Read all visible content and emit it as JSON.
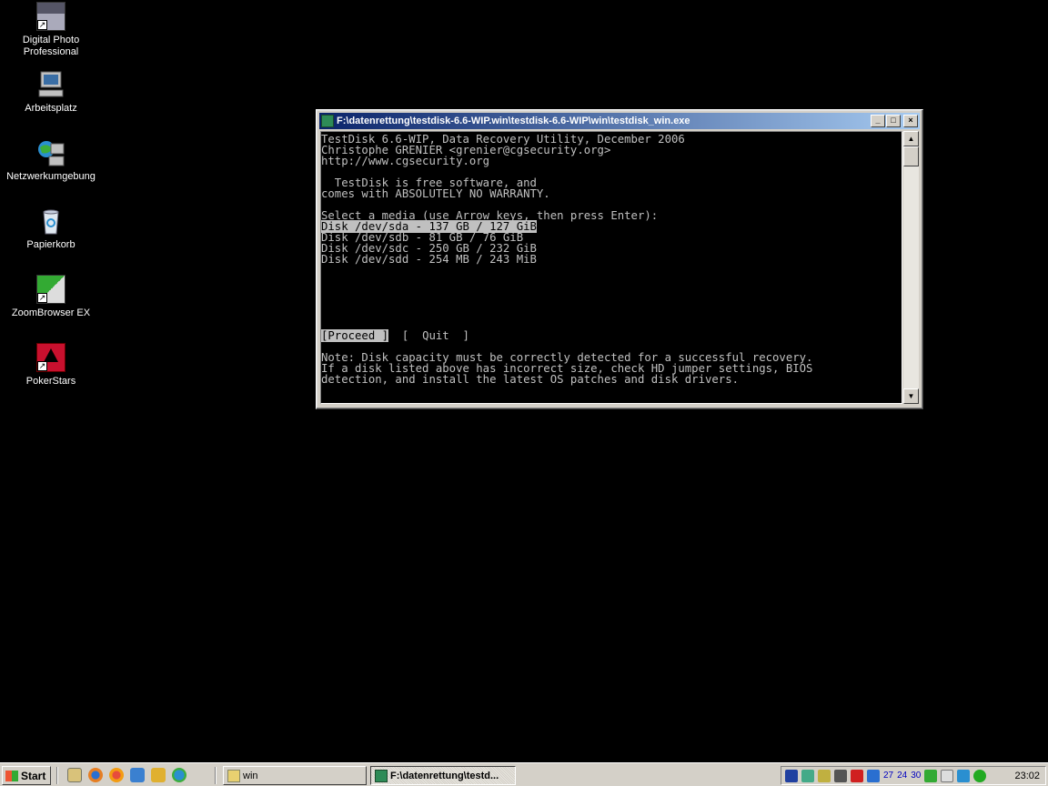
{
  "desktop": {
    "icons": [
      {
        "label": "Digital Photo Professional"
      },
      {
        "label": "Arbeitsplatz"
      },
      {
        "label": "Netzwerkumgebung"
      },
      {
        "label": "Papierkorb"
      },
      {
        "label": "ZoomBrowser EX"
      },
      {
        "label": "PokerStars"
      }
    ]
  },
  "window": {
    "title": "F:\\datenrettung\\testdisk-6.6-WIP.win\\testdisk-6.6-WIP\\win\\testdisk_win.exe",
    "minimize": "_",
    "maximize": "□",
    "close": "×",
    "console": {
      "header1": "TestDisk 6.6-WIP, Data Recovery Utility, December 2006",
      "header2": "Christophe GRENIER <grenier@cgsecurity.org>",
      "header3": "http://www.cgsecurity.org",
      "license1": "  TestDisk is free software, and",
      "license2": "comes with ABSOLUTELY NO WARRANTY.",
      "prompt": "Select a media (use Arrow keys, then press Enter):",
      "disks": [
        "Disk /dev/sda - 137 GB / 127 GiB",
        "Disk /dev/sdb - 81 GB / 76 GiB",
        "Disk /dev/sdc - 250 GB / 232 GiB",
        "Disk /dev/sdd - 254 MB / 243 MiB"
      ],
      "proceed": "[Proceed ]",
      "quit": "  [  Quit  ]",
      "note1": "Note: Disk capacity must be correctly detected for a successful recovery.",
      "note2": "If a disk listed above has incorrect size, check HD jumper settings, BIOS",
      "note3": "detection, and install the latest OS patches and disk drivers."
    }
  },
  "taskbar": {
    "start": "Start",
    "tasks": [
      {
        "label": "win"
      },
      {
        "label": "F:\\datenrettung\\testd..."
      }
    ],
    "tray_numbers": [
      "27",
      "24",
      "30"
    ],
    "clock": "23:02"
  }
}
